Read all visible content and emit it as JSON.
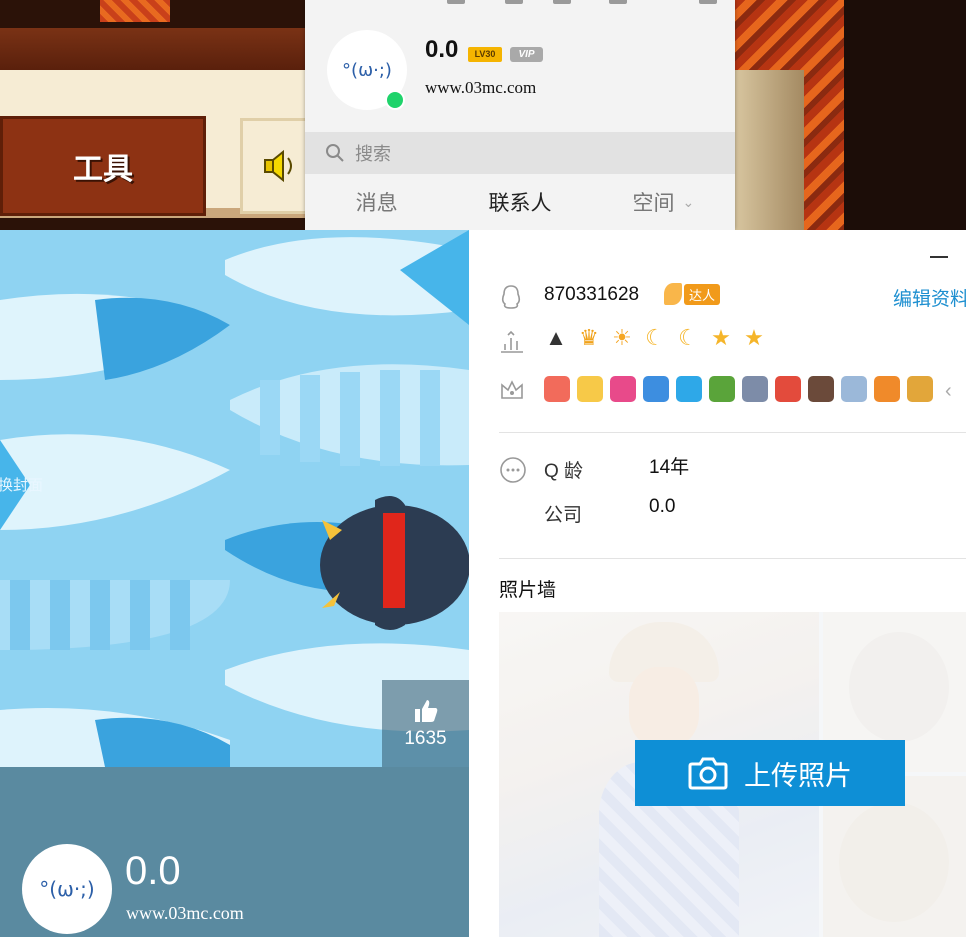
{
  "game": {
    "tools_label": "工具"
  },
  "qq_panel": {
    "nickname": "0.0",
    "level_badge": "LV30",
    "vip_badge": "VIP",
    "signature": "www.03mc.com",
    "search_placeholder": "搜索",
    "tabs": [
      {
        "label": "消息"
      },
      {
        "label": "联系人"
      },
      {
        "label": "空间"
      }
    ],
    "online_color": "#1fd36b"
  },
  "profile": {
    "change_cover_label": "换封面",
    "like_count": "1635",
    "nickname": "0.0",
    "signature": "www.03mc.com",
    "qq_number": "870331628",
    "expert_badge": "达人",
    "edit_profile_label": "编辑资料",
    "details": [
      {
        "label": "Q 龄",
        "value": "14年"
      },
      {
        "label": "公司",
        "value": "0.0"
      }
    ],
    "photo_wall_title": "照片墙",
    "upload_label": "上传照片",
    "accent_color": "#0e8fd6"
  },
  "icons": {
    "qq": "penguin-icon",
    "level": "level-icon",
    "crown": "crown-icon",
    "more": "more-icon",
    "search": "search-icon",
    "camera": "camera-icon",
    "thumb": "thumbs-up-icon"
  }
}
